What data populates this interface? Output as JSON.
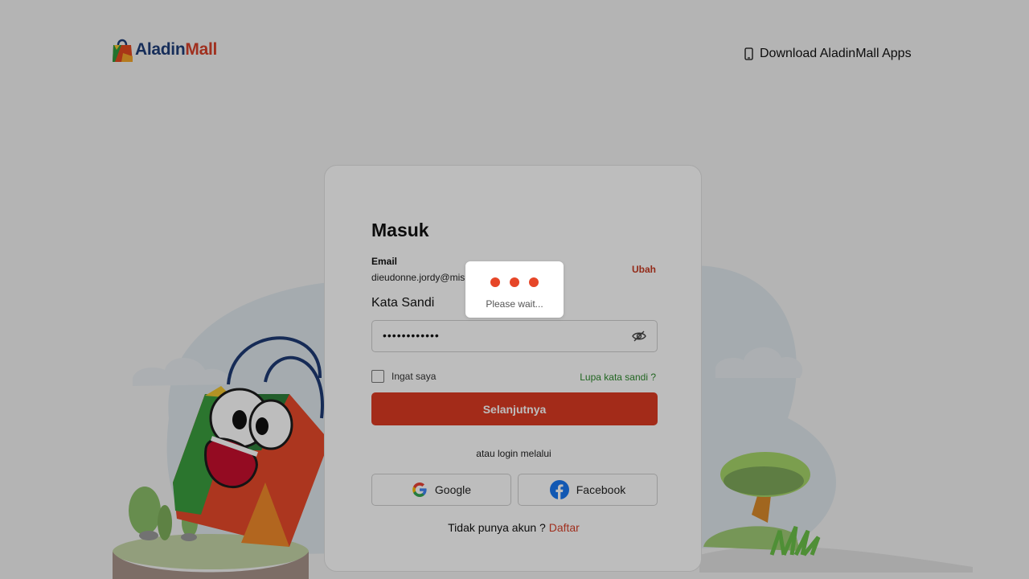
{
  "header": {
    "logo_aladin": "Aladin",
    "logo_mall": "Mall",
    "download_label": "Download AladinMall Apps"
  },
  "form": {
    "title": "Masuk",
    "email_label": "Email",
    "email_value": "dieudonne.jordy@mis",
    "change_label": "Ubah",
    "password_label": "Kata Sandi",
    "password_value": "••••••••••••",
    "remember_label": "Ingat saya",
    "remember_checked": false,
    "forgot_label": "Lupa kata sandi ?",
    "next_label": "Selanjutnya",
    "or_label": "atau login melalui",
    "google_label": "Google",
    "facebook_label": "Facebook",
    "signup_prompt": "Tidak punya akun ?",
    "signup_link": "Daftar"
  },
  "loader": {
    "text": "Please wait..."
  },
  "colors": {
    "brand_red": "#dc3a22",
    "brand_navy": "#1f3f7a",
    "link_green": "#2e8a2e",
    "loader_dot": "#e64628"
  },
  "icons": {
    "download": "phone-icon",
    "password_toggle": "eye-slash-icon",
    "google": "google-icon",
    "facebook": "facebook-icon"
  }
}
